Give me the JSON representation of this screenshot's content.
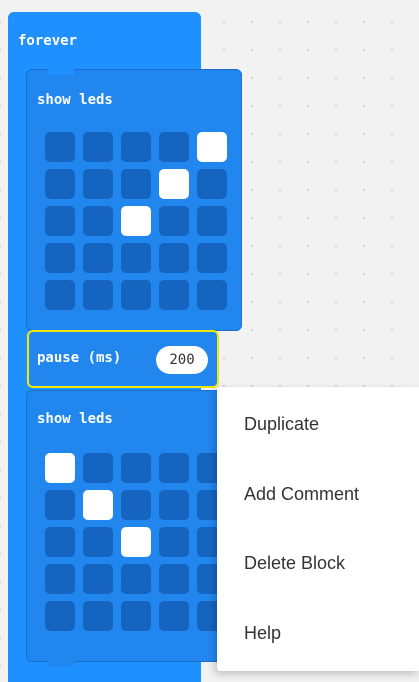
{
  "forever_block": {
    "label": "forever",
    "show_leds_1": {
      "label": "show leds",
      "leds": [
        [
          0,
          0,
          0,
          0,
          1
        ],
        [
          0,
          0,
          0,
          1,
          0
        ],
        [
          0,
          0,
          1,
          0,
          0
        ],
        [
          0,
          0,
          0,
          0,
          0
        ],
        [
          0,
          0,
          0,
          0,
          0
        ]
      ]
    },
    "pause": {
      "label": "pause (ms)",
      "value": "200"
    },
    "show_leds_2": {
      "label": "show leds",
      "leds": [
        [
          1,
          0,
          0,
          0,
          0
        ],
        [
          0,
          1,
          0,
          0,
          0
        ],
        [
          0,
          0,
          1,
          0,
          0
        ],
        [
          0,
          0,
          0,
          0,
          0
        ],
        [
          0,
          0,
          0,
          0,
          0
        ]
      ]
    }
  },
  "context_menu": {
    "items": [
      {
        "label": "Duplicate"
      },
      {
        "label": "Add Comment"
      },
      {
        "label": "Delete Block"
      },
      {
        "label": "Help"
      }
    ]
  },
  "colors": {
    "block_blue": "#1e90ff",
    "led_off": "#1565c0",
    "led_on": "#ffffff",
    "selection_yellow": "#f2e60b"
  }
}
